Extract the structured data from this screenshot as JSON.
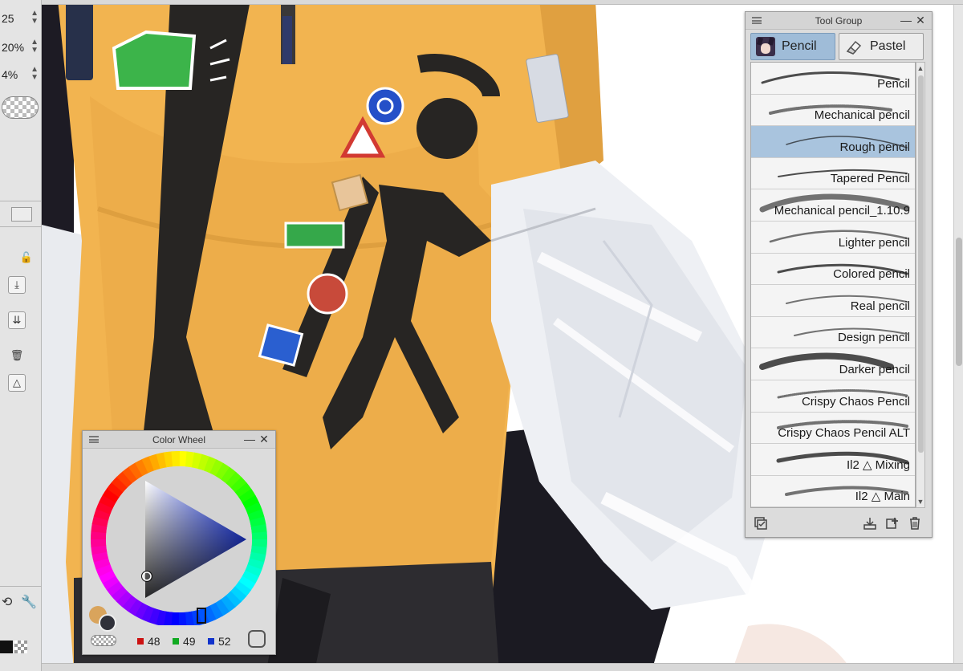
{
  "left_panel": {
    "row1": "25",
    "row2": "20%",
    "row3": "4%"
  },
  "tool_group": {
    "title": "Tool Group",
    "tabs": [
      {
        "label": "Pencil",
        "icon": "avatar-icon",
        "active": true
      },
      {
        "label": "Pastel",
        "icon": "eraser-icon",
        "active": false
      }
    ],
    "brushes": [
      {
        "name": "Pencil"
      },
      {
        "name": "Mechanical pencil"
      },
      {
        "name": "Rough pencil",
        "selected": true
      },
      {
        "name": "Tapered Pencil"
      },
      {
        "name": "Mechanical pencil_1.10.9"
      },
      {
        "name": "Lighter pencil"
      },
      {
        "name": "Colored pencil"
      },
      {
        "name": "Real pencil"
      },
      {
        "name": "Design pencil"
      },
      {
        "name": "Darker pencil"
      },
      {
        "name": "Crispy Chaos Pencil"
      },
      {
        "name": "Crispy Chaos Pencil ALT"
      },
      {
        "name": "Il2 △ Mixing"
      },
      {
        "name": "Il2 △ Main"
      }
    ],
    "footer_icons": [
      "settings-icon",
      "download-icon",
      "add-icon",
      "trash-icon"
    ]
  },
  "color_wheel": {
    "title": "Color Wheel",
    "main_color": "#30313a",
    "sub_color": "#d9a45c",
    "r": "48",
    "g": "49",
    "b": "52",
    "r_color": "#cc1111",
    "g_color": "#11aa22",
    "b_color": "#1133cc"
  },
  "colors": {
    "shirt": "#f2b450",
    "shirt_shadow": "#d99a3c",
    "black_stripe": "#272523",
    "sleeve": "#f1f2f5",
    "panel_bg": "#dcdcdc",
    "selection": "#a9c4de"
  }
}
